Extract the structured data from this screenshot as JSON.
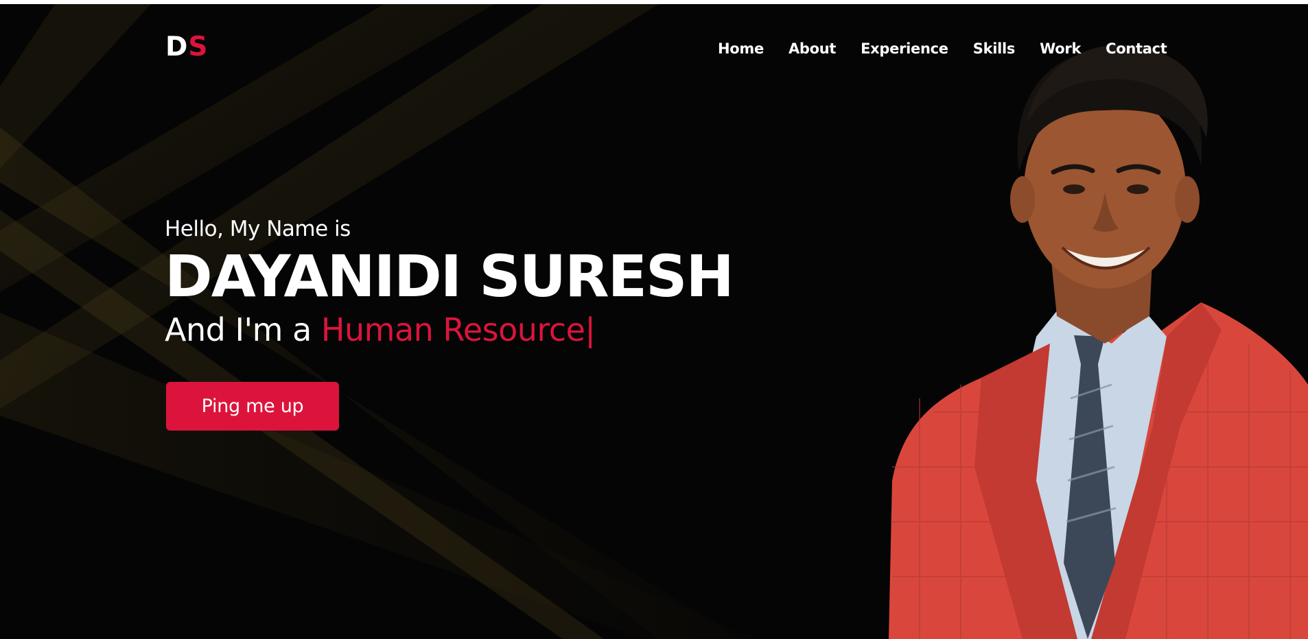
{
  "logo": {
    "first": "D",
    "second": "S"
  },
  "nav": {
    "items": [
      {
        "label": "Home"
      },
      {
        "label": "About"
      },
      {
        "label": "Experience"
      },
      {
        "label": "Skills"
      },
      {
        "label": "Work"
      },
      {
        "label": "Contact"
      }
    ]
  },
  "hero": {
    "greeting": "Hello, My Name is",
    "name": "DAYANIDI SURESH",
    "tagline_prefix": "And I'm a ",
    "role": "Human Resource",
    "cursor": "|",
    "button_label": "Ping me up"
  },
  "colors": {
    "accent": "#dc143c",
    "background": "#050505",
    "text": "#ffffff"
  }
}
